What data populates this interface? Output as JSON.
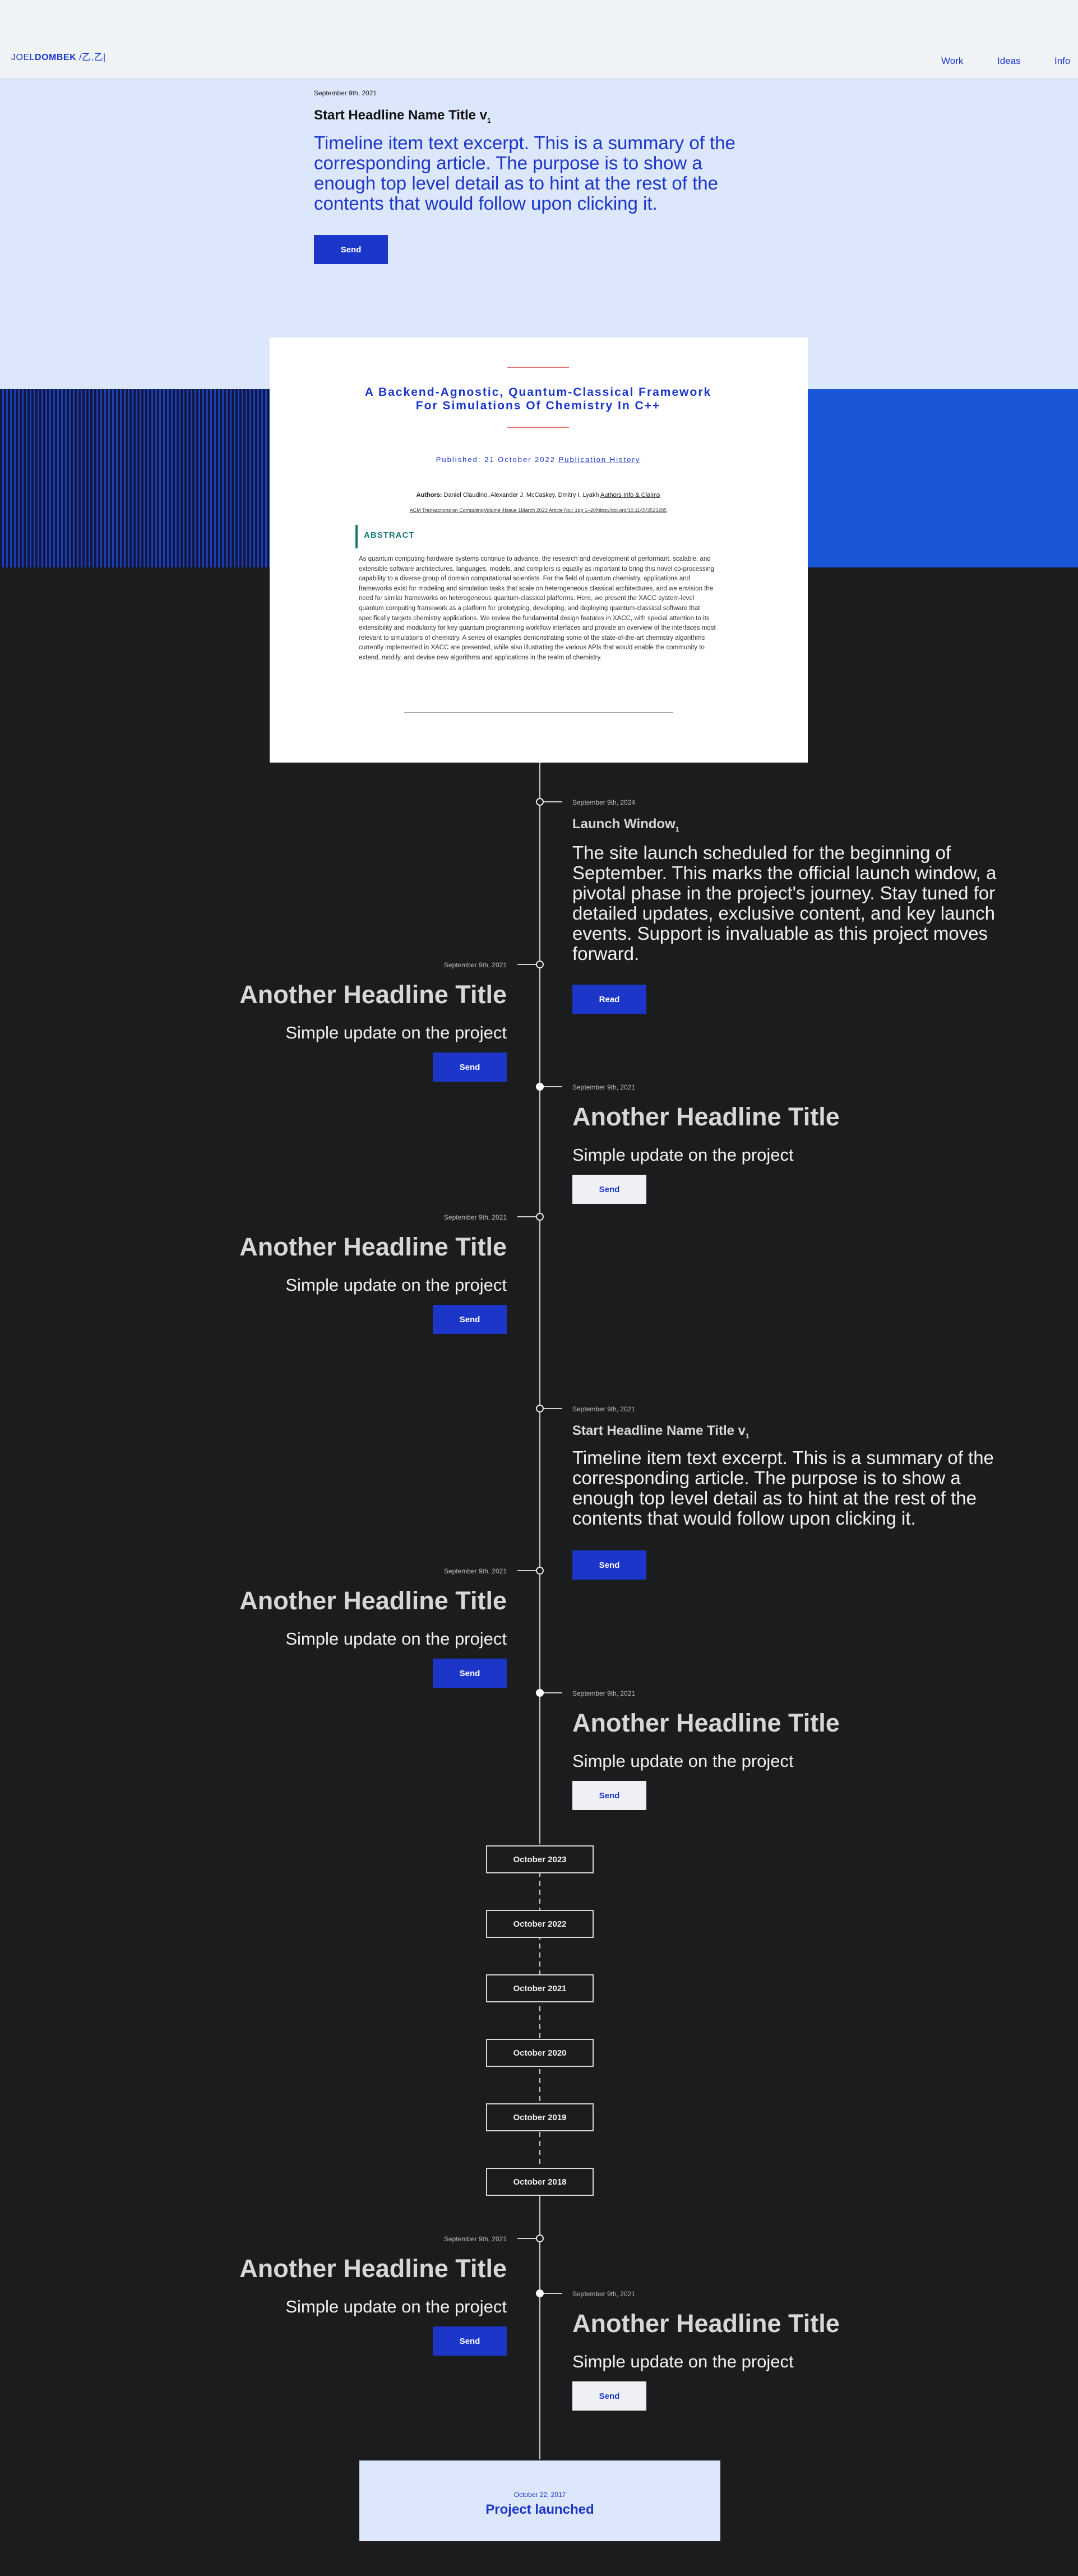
{
  "header": {
    "logo_first": "JOEL",
    "logo_last": "DOMBEK",
    "logo_glyph": "/乙,乙|",
    "nav": [
      "Work",
      "Ideas",
      "Info"
    ]
  },
  "intro": {
    "date": "September 9th, 2021",
    "title": "Start Headline Name Title v",
    "title_sub": "1",
    "excerpt": "Timeline item text excerpt. This is a summary of the corresponding article. The purpose is to show a enough top level detail as to hint at the rest of the contents that would follow upon clicking it.",
    "button": "Send"
  },
  "paper": {
    "title": "A Backend-Agnostic, Quantum-Classical Framework For Simulations Of Chemistry In C++",
    "published": "Published: 21 October 2022",
    "history_link": "Publication History",
    "authors_label": "Authors:",
    "authors": "Daniel Claudino, Alexander J. McCaskey, Dmitry I. Lyakh",
    "authors_link": "Authors Info & Claims",
    "journal_link": "ACM Transactions on Computing",
    "journal_rest": "Volume 4Issue 1March 2023 Article No.: 1pp 1–20",
    "doi": "https://doi.org/10.1145/3523285",
    "abstract_heading": "ABSTRACT",
    "abstract": "As quantum computing hardware systems continue to advance, the research and development of performant, scalable, and extensible software architectures, languages, models, and compilers is equally as important to bring this novel co-processing capability to a diverse group of domain computational scientists. For the field of quantum chemistry, applications and frameworks exist for modeling and simulation tasks that scale on heterogeneous classical architectures, and we envision the need for similar frameworks on heterogeneous quantum-classical platforms. Here, we present the XACC system-level quantum computing framework as a platform for prototyping, developing, and deploying quantum-classical software that specifically targets chemistry applications. We review the fundamental design features in XACC, with special attention to its extensibility and modularity for key quantum programming workflow interfaces and provide an overview of the interfaces most relevant to simulations of chemistry. A series of examples demonstrating some of the state-of-the-art chemistry algorithms currently implemented in XACC are presented, while also illustrating the various APIs that would enable the community to extend, modify, and devise new algorithms and applications in the realm of chemistry."
  },
  "timeline": {
    "launch": {
      "date": "September 9th, 2024",
      "title": "Launch Window",
      "title_sub": "1",
      "text": "The site launch scheduled for the beginning of September. This marks the official launch window, a pivotal phase in the project's journey. Stay tuned for detailed updates, exclusive content, and key launch events. Support is invaluable as this project moves forward.",
      "button": "Read"
    },
    "items": [
      {
        "date": "September 9th, 2021",
        "headline": "Another Headline Title",
        "sub": "Simple update on the project",
        "button": "Send"
      },
      {
        "date": "September 9th, 2021",
        "headline": "Another Headline Title",
        "sub": "Simple update on the project",
        "button": "Send"
      },
      {
        "date": "September 9th, 2021",
        "headline": "Another Headline Title",
        "sub": "Simple update on the project",
        "button": "Send"
      },
      {
        "date": "September 9th, 2021",
        "title": "Start Headline Name Title v",
        "title_sub": "1",
        "text": "Timeline item text excerpt. This is a summary of the corresponding article. The purpose is to show a enough top level detail as to hint at the rest of the contents that would follow upon clicking it.",
        "button": "Send"
      },
      {
        "date": "September 9th, 2021",
        "headline": "Another Headline Title",
        "sub": "Simple update on the project",
        "button": "Send"
      },
      {
        "date": "September 9th, 2021",
        "headline": "Another Headline Title",
        "sub": "Simple update on the project",
        "button": "Send"
      },
      {
        "date": "September 9th, 2021",
        "headline": "Another Headline Title",
        "sub": "Simple update on the project",
        "button": "Send"
      },
      {
        "date": "September 9th, 2021",
        "headline": "Another Headline Title",
        "sub": "Simple update on the project",
        "button": "Send"
      }
    ],
    "years": [
      "October 2023",
      "October 2022",
      "October 2021",
      "October 2020",
      "October 2019",
      "October 2018"
    ],
    "end": {
      "date": "October 22, 2017",
      "title": "Project launched"
    }
  },
  "colors": {
    "accent": "#1b36c9",
    "background": "#1b1c1d",
    "light_panel": "#dde7fb",
    "abstract": "#1a7a76"
  }
}
